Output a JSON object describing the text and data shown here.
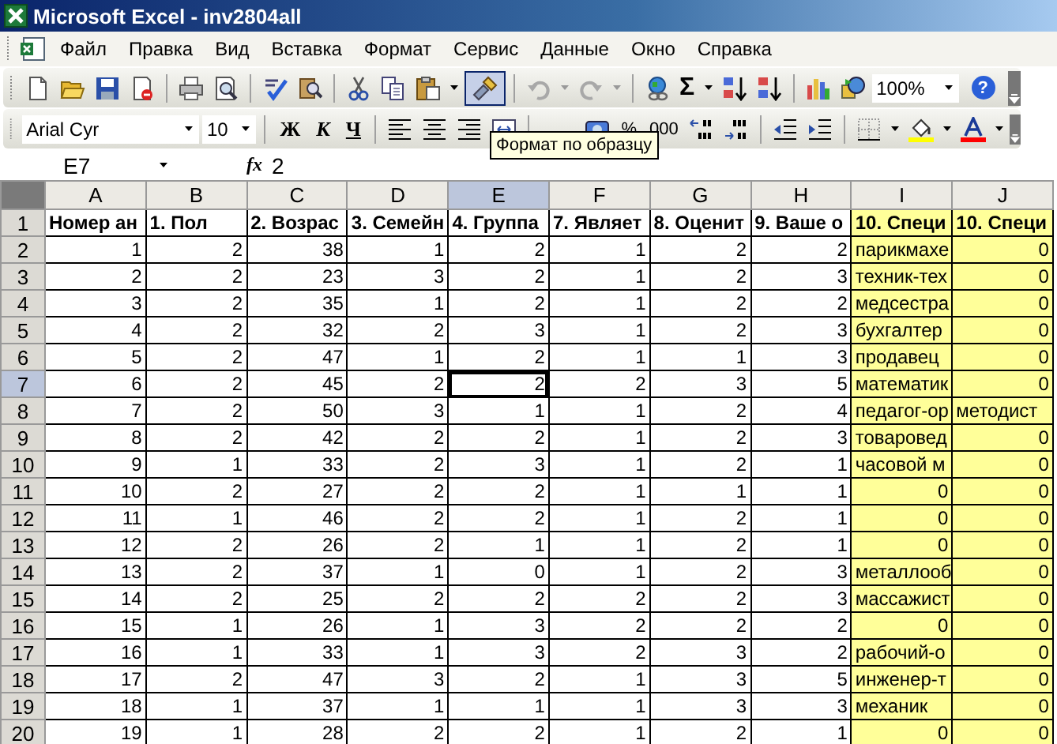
{
  "window": {
    "title": "Microsoft Excel - inv2804all"
  },
  "menu": [
    "Файл",
    "Правка",
    "Вид",
    "Вставка",
    "Формат",
    "Сервис",
    "Данные",
    "Окно",
    "Справка"
  ],
  "standard_toolbar": {
    "format_painter_pressed": true,
    "undo_disabled": true,
    "redo_disabled": true,
    "sum": "Σ",
    "zoom": "100%",
    "help": "?"
  },
  "formatting_toolbar": {
    "font": "Arial Cyr",
    "size": "10",
    "bold": "Ж",
    "italic": "К",
    "underline": "Ч",
    "percent": "%",
    "thousands": "000"
  },
  "tooltip": "Формат по образцу",
  "formula_bar": {
    "name_box": "E7",
    "fx": "fx",
    "value": "2"
  },
  "sheet": {
    "columns": [
      {
        "label": "A",
        "selected": false,
        "color": "#ffffff"
      },
      {
        "label": "B",
        "selected": false,
        "color": "#ffffff"
      },
      {
        "label": "C",
        "selected": false,
        "color": "#ffffff"
      },
      {
        "label": "D",
        "selected": false,
        "color": "#ffffff"
      },
      {
        "label": "E",
        "selected": true,
        "color": "#ffffff"
      },
      {
        "label": "F",
        "selected": false,
        "color": "#ffffff"
      },
      {
        "label": "G",
        "selected": false,
        "color": "#ffffff"
      },
      {
        "label": "H",
        "selected": false,
        "color": "#ffffff"
      },
      {
        "label": "I",
        "selected": false,
        "color": "#ffff99"
      },
      {
        "label": "J",
        "selected": false,
        "color": "#ffff99"
      }
    ],
    "rows": [
      {
        "number": "1",
        "selected": false,
        "kind": "header",
        "cells": [
          "Номер ан",
          "1. Пол",
          "2. Возрас",
          "3. Семейн",
          "4. Группа",
          "7. Являет",
          "8. Оценит",
          "9. Ваше о",
          "10. Специ",
          "10. Специ"
        ]
      },
      {
        "number": "2",
        "selected": false,
        "kind": "data",
        "cells": [
          "1",
          "2",
          "38",
          "1",
          "2",
          "1",
          "2",
          "2",
          {
            "text": "парикмахе"
          },
          "0"
        ]
      },
      {
        "number": "3",
        "selected": false,
        "kind": "data",
        "cells": [
          "2",
          "2",
          "23",
          "3",
          "2",
          "1",
          "2",
          "3",
          {
            "text": "техник-тех"
          },
          "0"
        ]
      },
      {
        "number": "4",
        "selected": false,
        "kind": "data",
        "cells": [
          "3",
          "2",
          "35",
          "1",
          "2",
          "1",
          "2",
          "2",
          {
            "text": "медсестра"
          },
          "0"
        ]
      },
      {
        "number": "5",
        "selected": false,
        "kind": "data",
        "cells": [
          "4",
          "2",
          "32",
          "2",
          "3",
          "1",
          "2",
          "3",
          {
            "text": "бухгалтер"
          },
          "0"
        ]
      },
      {
        "number": "6",
        "selected": false,
        "kind": "data",
        "cells": [
          "5",
          "2",
          "47",
          "1",
          "2",
          "1",
          "1",
          "3",
          {
            "text": "продавец"
          },
          "0"
        ]
      },
      {
        "number": "7",
        "selected": true,
        "kind": "data",
        "cells": [
          "6",
          "2",
          "45",
          "2",
          "2",
          "2",
          "3",
          "5",
          {
            "text": "математик"
          },
          "0"
        ]
      },
      {
        "number": "8",
        "selected": false,
        "kind": "data",
        "cells": [
          "7",
          "2",
          "50",
          "3",
          "1",
          "1",
          "2",
          "4",
          {
            "text": "педагог-ор"
          },
          {
            "text": "методист"
          }
        ]
      },
      {
        "number": "9",
        "selected": false,
        "kind": "data",
        "cells": [
          "8",
          "2",
          "42",
          "2",
          "2",
          "1",
          "2",
          "3",
          {
            "text": "товаровед"
          },
          "0"
        ]
      },
      {
        "number": "10",
        "selected": false,
        "kind": "data",
        "cells": [
          "9",
          "1",
          "33",
          "2",
          "3",
          "1",
          "2",
          "1",
          {
            "text": "часовой м"
          },
          "0"
        ]
      },
      {
        "number": "11",
        "selected": false,
        "kind": "data",
        "cells": [
          "10",
          "2",
          "27",
          "2",
          "2",
          "1",
          "1",
          "1",
          "0",
          "0"
        ]
      },
      {
        "number": "12",
        "selected": false,
        "kind": "data",
        "cells": [
          "11",
          "1",
          "46",
          "2",
          "2",
          "1",
          "2",
          "1",
          "0",
          "0"
        ]
      },
      {
        "number": "13",
        "selected": false,
        "kind": "data",
        "cells": [
          "12",
          "2",
          "26",
          "2",
          "1",
          "1",
          "2",
          "1",
          "0",
          "0"
        ]
      },
      {
        "number": "14",
        "selected": false,
        "kind": "data",
        "cells": [
          "13",
          "2",
          "37",
          "1",
          "0",
          "1",
          "2",
          "3",
          {
            "text": "металлооб"
          },
          "0"
        ]
      },
      {
        "number": "15",
        "selected": false,
        "kind": "data",
        "cells": [
          "14",
          "2",
          "25",
          "2",
          "2",
          "2",
          "2",
          "3",
          {
            "text": "массажист"
          },
          "0"
        ]
      },
      {
        "number": "16",
        "selected": false,
        "kind": "data",
        "cells": [
          "15",
          "1",
          "26",
          "1",
          "3",
          "2",
          "2",
          "2",
          "0",
          "0"
        ]
      },
      {
        "number": "17",
        "selected": false,
        "kind": "data",
        "cells": [
          "16",
          "1",
          "33",
          "1",
          "3",
          "2",
          "3",
          "2",
          {
            "text": "рабочий-о"
          },
          "0"
        ]
      },
      {
        "number": "18",
        "selected": false,
        "kind": "data",
        "cells": [
          "17",
          "2",
          "47",
          "3",
          "2",
          "1",
          "3",
          "5",
          {
            "text": "инженер-т"
          },
          "0"
        ]
      },
      {
        "number": "19",
        "selected": false,
        "kind": "data",
        "cells": [
          "18",
          "1",
          "37",
          "1",
          "1",
          "1",
          "3",
          "3",
          {
            "text": "механик"
          },
          "0"
        ]
      },
      {
        "number": "20",
        "selected": false,
        "kind": "data",
        "cells": [
          "19",
          "1",
          "28",
          "2",
          "2",
          "1",
          "2",
          "1",
          "0",
          "0"
        ]
      }
    ]
  }
}
